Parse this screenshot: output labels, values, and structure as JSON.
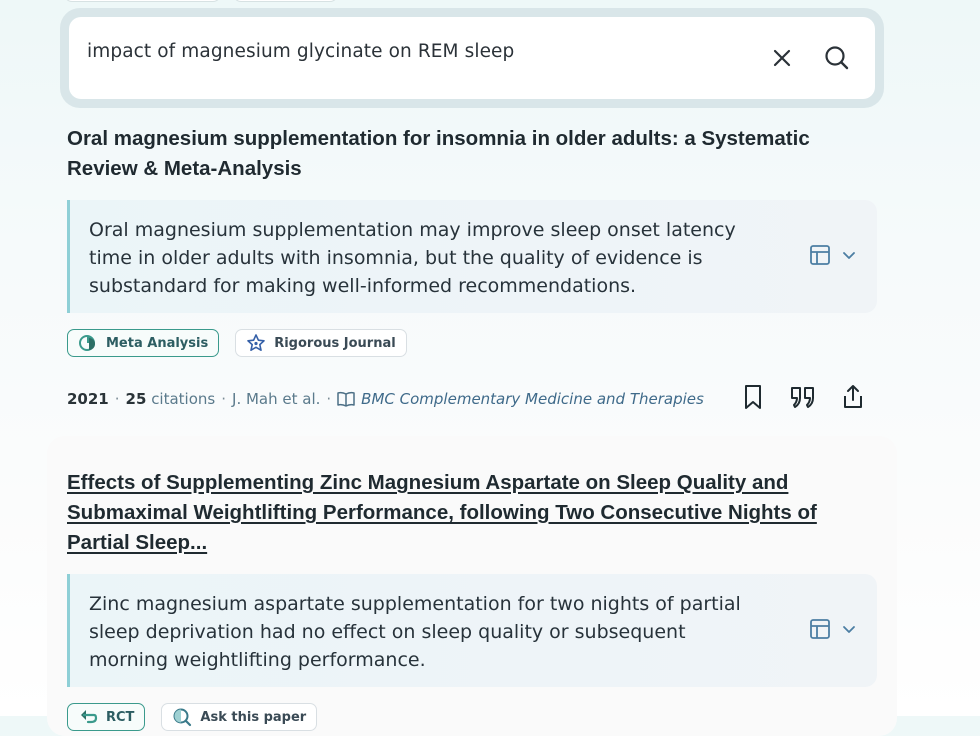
{
  "search": {
    "query": "impact of magnesium glycinate on REM sleep",
    "clear_icon": "close-icon",
    "search_icon": "search-icon"
  },
  "results": [
    {
      "title": "Oral magnesium supplementation for insomnia in older adults: a Systematic Review & Meta-Analysis",
      "summary": "Oral magnesium supplementation may improve sleep onset latency time in older adults with insomnia, but the quality of evidence is substandard for making well-informed recommendations.",
      "badges": [
        "Meta Analysis",
        "Rigorous Journal"
      ],
      "year": "2021",
      "citations_count": "25",
      "citations_label": "citations",
      "authors": "J. Mah et al.",
      "journal": "BMC Complementary Medicine and Therapies"
    },
    {
      "title": "Effects of Supplementing Zinc Magnesium Aspartate on Sleep Quality and Submaximal Weightlifting Performance, following Two Consecutive Nights of Partial Sleep...",
      "summary": "Zinc magnesium aspartate supplementation for two nights of partial sleep deprivation had no effect on sleep quality or subsequent morning weightlifting performance.",
      "badges": [
        "RCT",
        "Ask this paper"
      ]
    }
  ],
  "colors": {
    "accent": "#3a9a8c",
    "summary_border": "#8ecfd6",
    "link": "#3f6a8a"
  }
}
